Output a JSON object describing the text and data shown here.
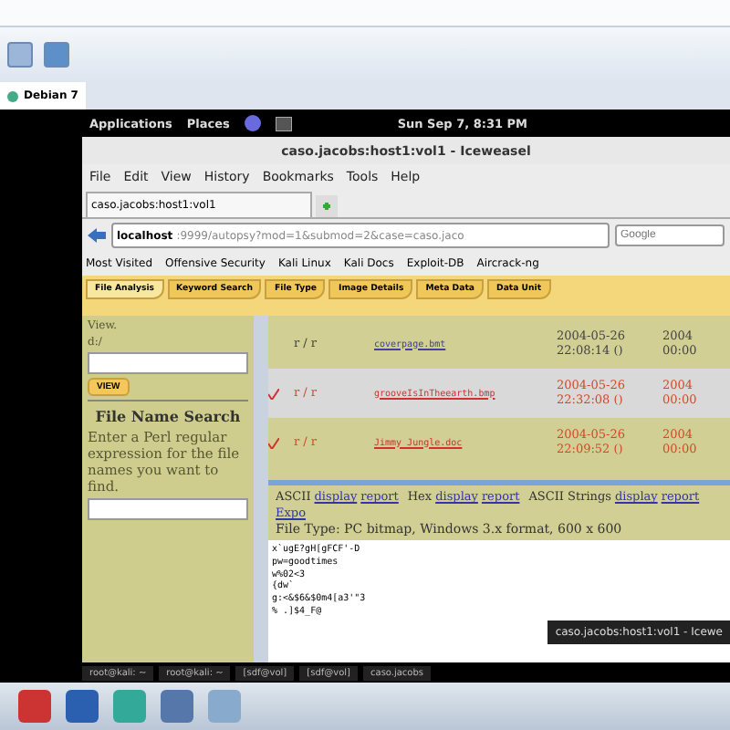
{
  "vm_tab": {
    "label": "Debian 7"
  },
  "desktop_panel": {
    "menus": [
      "Applications",
      "Places"
    ],
    "clock": "Sun Sep  7,  8:31 PM"
  },
  "browser": {
    "title": "caso.jacobs:host1:vol1 - Iceweasel",
    "menu": [
      "File",
      "Edit",
      "View",
      "History",
      "Bookmarks",
      "Tools",
      "Help"
    ],
    "tab": "caso.jacobs:host1:vol1",
    "url": {
      "host": "localhost",
      "rest": ":9999/autopsy?mod=1&submod=2&case=caso.jaco"
    },
    "search": {
      "placeholder": "Google"
    },
    "bookmarks": [
      "Most Visited",
      "Offensive Security",
      "Kali Linux",
      "Kali Docs",
      "Exploit-DB",
      "Aircrack-ng"
    ]
  },
  "autopsy": {
    "tabs": [
      {
        "label": "File Analysis",
        "selected": true
      },
      {
        "label": "Keyword Search",
        "selected": false
      },
      {
        "label": "File Type",
        "selected": false
      },
      {
        "label": "Image Details",
        "selected": false
      },
      {
        "label": "Meta Data",
        "selected": false
      },
      {
        "label": "Data Unit",
        "selected": false
      }
    ],
    "sidebar": {
      "view_label": "View.",
      "path": "d:/",
      "view_button": "VIEW",
      "search_title": "File Name Search",
      "search_help": "Enter a Perl regular expression for the file names you want to find."
    },
    "files": [
      {
        "deleted": false,
        "type": "r / r",
        "name": "coverpage.bmt",
        "written": "2004-05-26 22:08:14 ()",
        "accessed": "2004 00:00"
      },
      {
        "deleted": true,
        "type": "r / r",
        "name": "grooveIsInTheearth.bmp",
        "written": "2004-05-26 22:32:08 ()",
        "accessed": "2004 00:00"
      },
      {
        "deleted": true,
        "type": "r / r",
        "name": "Jimmy Jungle.doc",
        "written": "2004-05-26 22:09:52 ()",
        "accessed": "2004 00:00"
      }
    ],
    "views": [
      {
        "name": "ASCII",
        "display": "display",
        "report": "report"
      },
      {
        "name": "Hex",
        "display": "display",
        "report": "report"
      },
      {
        "name": "ASCII Strings",
        "display": "display",
        "report": "report"
      }
    ],
    "export": "Expo",
    "file_type": "File Type: PC bitmap, Windows 3.x format, 600 x 600",
    "content": [
      "x`ugE?gH[gFCF'-D",
      "pw=goodtimes",
      "w%02<3",
      "{dw`",
      "g:<&$6&$0m4[a3'\"3",
      "% .]$4_F@"
    ]
  },
  "tooltip": "caso.jacobs:host1:vol1 - Icewe",
  "tasks": [
    "root@kali: ~",
    "root@kali: ~",
    "[sdf@vol]",
    "[sdf@vol]",
    "caso.jacobs"
  ]
}
